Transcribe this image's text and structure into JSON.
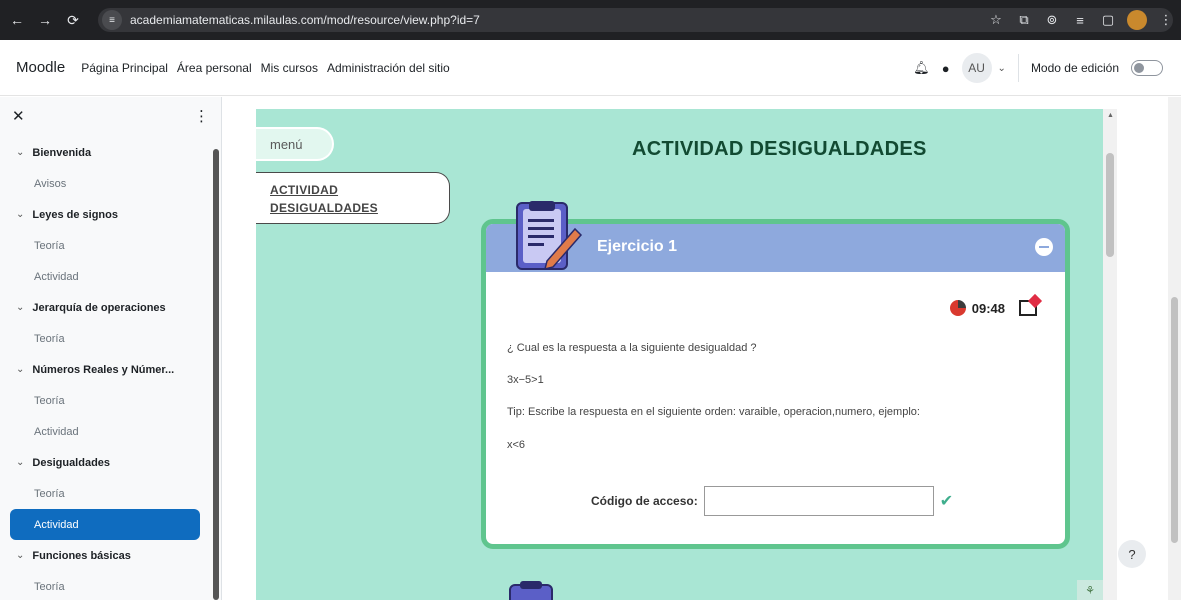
{
  "browser": {
    "url": "academiamatematicas.milaulas.com/mod/resource/view.php?id=7",
    "nav_icons": [
      "back-arrow-icon",
      "forward-arrow-icon",
      "reload-icon"
    ]
  },
  "topnav": {
    "brand": "Moodle",
    "links": [
      "Página Principal",
      "Área personal",
      "Mis cursos",
      "Administración del sitio"
    ],
    "avatar": "AU",
    "edit_mode": "Modo de edición"
  },
  "drawer": {
    "items": [
      {
        "type": "section",
        "label": "Bienvenida"
      },
      {
        "type": "item",
        "label": "Avisos"
      },
      {
        "type": "section",
        "label": "Leyes de signos"
      },
      {
        "type": "item",
        "label": "Teoría"
      },
      {
        "type": "item",
        "label": "Actividad"
      },
      {
        "type": "section",
        "label": "Jerarquía de operaciones"
      },
      {
        "type": "item",
        "label": "Teoría"
      },
      {
        "type": "section",
        "label": "Números Reales y Númer..."
      },
      {
        "type": "item",
        "label": "Teoría"
      },
      {
        "type": "item",
        "label": "Actividad"
      },
      {
        "type": "section",
        "label": "Desigualdades"
      },
      {
        "type": "item",
        "label": "Teoría"
      },
      {
        "type": "item",
        "label": "Actividad",
        "active": true
      },
      {
        "type": "section",
        "label": "Funciones básicas"
      },
      {
        "type": "item",
        "label": "Teoría"
      }
    ]
  },
  "activity": {
    "menu_label": "menú",
    "nav_card_line1": "ACTIVIDAD",
    "nav_card_line2": "DESIGUALDADES",
    "title": "ACTIVIDAD DESIGUALDADES",
    "exercise_title": "Ejercicio 1",
    "timer": "09:48",
    "question": "¿ Cual es la respuesta a la siguiente desigualdad ?",
    "inequality": "3x−5>1",
    "tip": "Tip: Escribe la respuesta en el siguiente orden: varaible, operacion,numero, ejemplo:",
    "example": "x<6",
    "code_label": "Código de acceso:"
  },
  "help": "?",
  "colors": {
    "activity_bg": "#a9e6d4",
    "exercise_header": "#8ea9dd",
    "exercise_border": "#5fc58e",
    "active_item": "#0f6cbf"
  }
}
